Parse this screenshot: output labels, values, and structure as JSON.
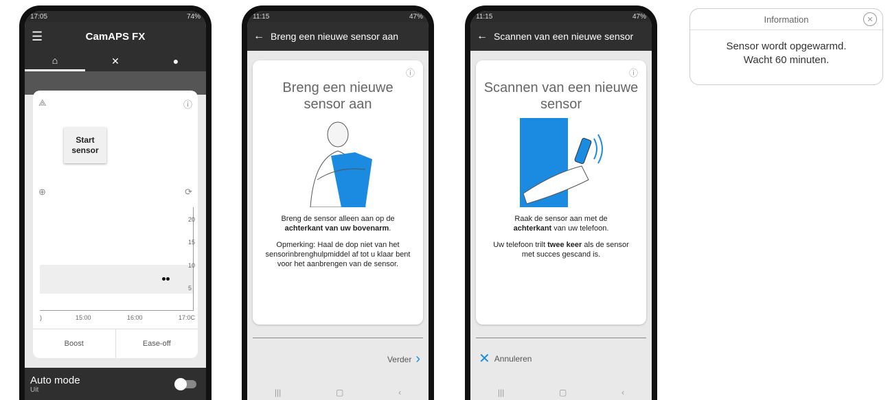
{
  "phone1": {
    "status": {
      "time": "17:05",
      "battery": "74%"
    },
    "title": "CamAPS FX",
    "start_sensor": "Start\nsensor",
    "yticks": [
      "20",
      "15",
      "10",
      "5"
    ],
    "xticks": [
      ")",
      "15:00",
      "16:00",
      "17:0C"
    ],
    "boost": "Boost",
    "easeoff": "Ease-off",
    "auto_mode": "Auto mode",
    "auto_state": "Uit",
    "menu_icon": "menu-icon"
  },
  "phone2": {
    "status": {
      "time": "11:15",
      "battery": "47%"
    },
    "title": "Breng een nieuwe sensor aan",
    "heading": "Breng een nieuwe sensor aan",
    "para1_a": "Breng de sensor alleen aan op de",
    "para1_b": "achterkant van uw bovenarm",
    "para1_c": ".",
    "para2": "Opmerking: Haal de dop niet van het sensorinbrenghulpmiddel af tot u klaar bent voor het aanbrengen van de sensor.",
    "next": "Verder"
  },
  "phone3": {
    "status": {
      "time": "11:15",
      "battery": "47%"
    },
    "title": "Scannen van een nieuwe sensor",
    "heading": "Scannen van een nieuwe sensor",
    "para1_a": "Raak de sensor aan met de",
    "para1_b": "achterkant",
    "para1_c": "van uw telefoon.",
    "para2_a": "Uw telefoon trilt",
    "para2_b": "twee keer",
    "para2_c": "als de sensor met succes gescand is.",
    "cancel": "Annuleren"
  },
  "popup": {
    "title": "Information",
    "line1": "Sensor wordt opgewarmd.",
    "line2": "Wacht 60 minuten."
  },
  "colors": {
    "accent": "#1a8be0",
    "dark": "#2f2f2f"
  }
}
